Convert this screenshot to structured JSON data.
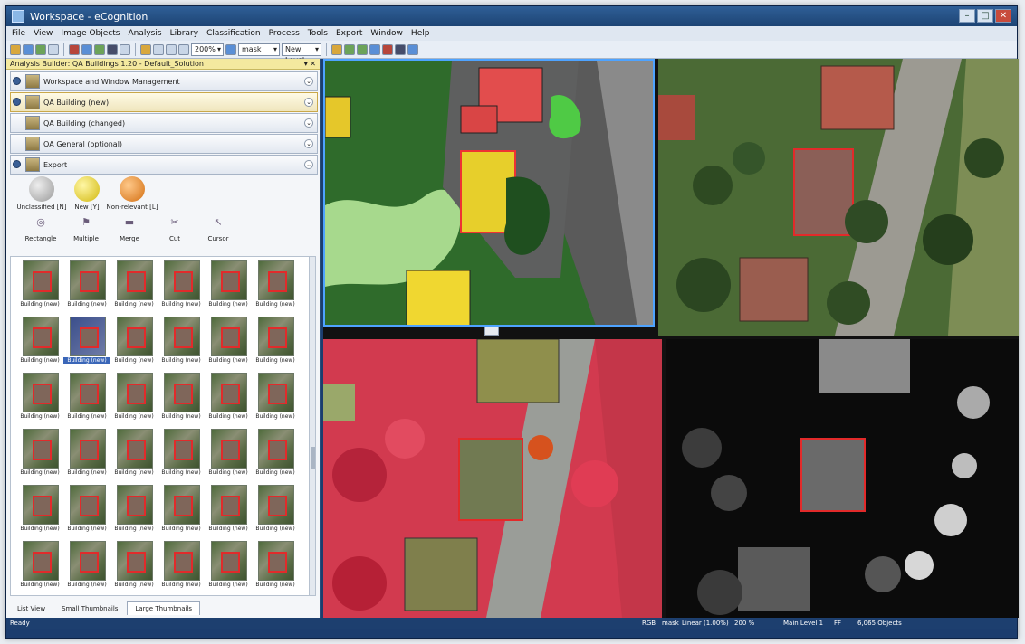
{
  "app": {
    "title": "Workspace - eCognition"
  },
  "menu": [
    "File",
    "View",
    "Image Objects",
    "Analysis",
    "Library",
    "Classification",
    "Process",
    "Tools",
    "Export",
    "Window",
    "Help"
  ],
  "toolbar": {
    "zoom": "200%",
    "layer": "mask",
    "level": "New Level"
  },
  "left_panel": {
    "title": "Analysis Builder: QA Buildings 1.20 - Default_Solution",
    "sections": [
      {
        "label": "Workspace and Window Management",
        "highlight": false
      },
      {
        "label": "QA Building (new)",
        "highlight": true
      },
      {
        "label": "QA Building (changed)",
        "highlight": false
      },
      {
        "label": "QA General (optional)",
        "highlight": false
      },
      {
        "label": "Export",
        "highlight": false
      }
    ],
    "classes": [
      {
        "label": "Unclassified [N]",
        "color": "#b9b9b9"
      },
      {
        "label": "New [Y]",
        "color": "#e6d21f"
      },
      {
        "label": "Non-relevant [L]",
        "color": "#e0862d"
      }
    ],
    "tools": [
      {
        "label": "Rectangle",
        "icon": "rectangle-icon",
        "glyph": "◎"
      },
      {
        "label": "Multiple",
        "icon": "multiple-select-icon",
        "glyph": "⚑"
      },
      {
        "label": "Merge",
        "icon": "merge-icon",
        "glyph": "▬"
      },
      {
        "label": "Cut",
        "icon": "cut-icon",
        "glyph": "✂"
      },
      {
        "label": "Cursor",
        "icon": "cursor-icon",
        "glyph": "↖"
      }
    ],
    "thumbnail_label": "Building (new)",
    "thumb_count": 36,
    "selected_thumb": 7,
    "tabs": [
      {
        "label": "List View",
        "active": false
      },
      {
        "label": "Small Thumbnails",
        "active": false
      },
      {
        "label": "Large Thumbnails",
        "active": true
      }
    ]
  },
  "status": {
    "left": "Ready",
    "rgb": "RGB",
    "layer": "mask",
    "stretch": "Linear (1.00%)",
    "zoom": "200 %",
    "level": "Main Level 1",
    "pixel": "FF",
    "objects": "6,065 Objects"
  }
}
